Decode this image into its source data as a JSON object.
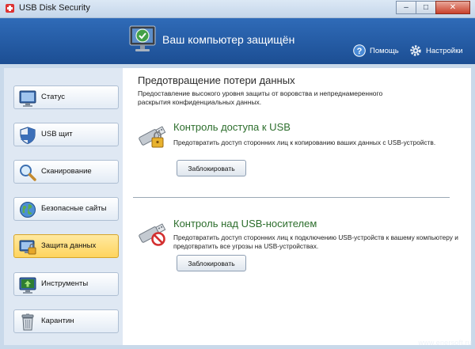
{
  "window": {
    "title": "USB Disk Security"
  },
  "header": {
    "title": "Ваш компьютер защищён",
    "help_label": "Помощь",
    "settings_label": "Настройки"
  },
  "sidebar": {
    "items": [
      {
        "label": "Статус",
        "icon": "status-icon"
      },
      {
        "label": "USB щит",
        "icon": "shield-icon"
      },
      {
        "label": "Сканирование",
        "icon": "magnifier-icon"
      },
      {
        "label": "Безопасные сайты",
        "icon": "globe-icon"
      },
      {
        "label": "Защита данных",
        "icon": "data-protection-icon",
        "active": true
      },
      {
        "label": "Инструменты",
        "icon": "tools-icon"
      },
      {
        "label": "Карантин",
        "icon": "trash-icon"
      }
    ]
  },
  "main": {
    "title": "Предотвращение потери данных",
    "description": "Предоставление высокого уровня защиты от воровства и непреднамеренного раскрытия конфиденциальных данных.",
    "sections": [
      {
        "title": "Контроль доступа к USB",
        "description": "Предотвратить доступ сторонних лиц к копированию ваших данных с USB-устройств.",
        "button_label": "Заблокировать",
        "icon": "usb-lock-icon"
      },
      {
        "title": "Контроль над USB-носителем",
        "description": "Предотвратить доступ сторонних лиц к подключению USB-устройств к вашему компьютеру и предотвратить все угрозы на USB-устройствах.",
        "button_label": "Заблокировать",
        "icon": "usb-blocked-icon"
      }
    ]
  },
  "watermark": "www.enersoft.ru",
  "colors": {
    "header": "#1c4e93",
    "active_item": "#ffd45e",
    "section_title": "#2d6e2d"
  }
}
